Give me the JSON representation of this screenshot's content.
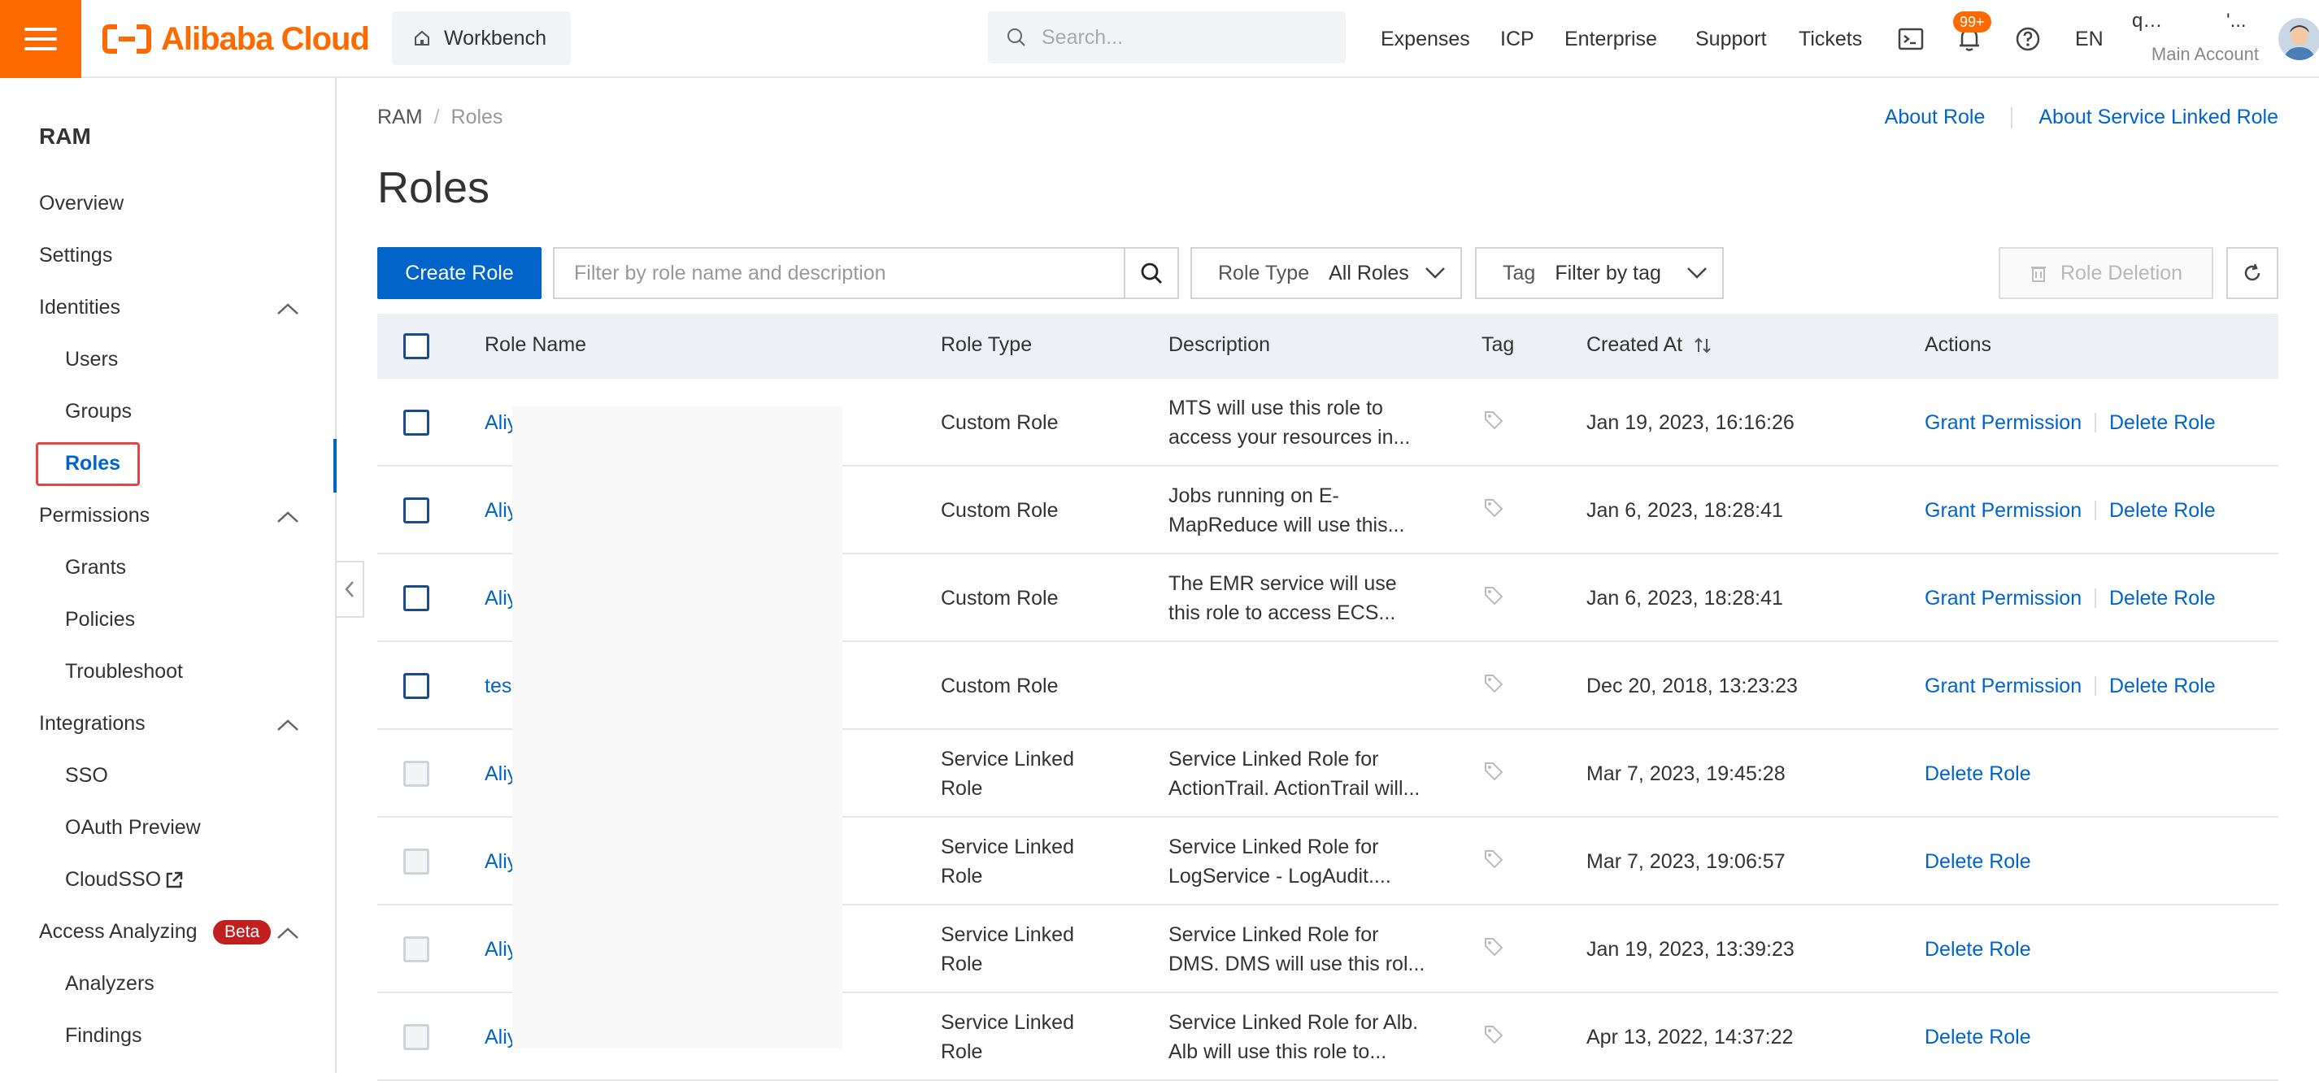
{
  "topbar": {
    "brand": "Alibaba Cloud",
    "workbench": "Workbench",
    "search_placeholder": "Search...",
    "nav": [
      "Expenses",
      "ICP",
      "Enterprise",
      "Support",
      "Tickets"
    ],
    "notification_badge": "99+",
    "language": "EN",
    "account_name": "q…",
    "account_name_tail": "'...",
    "account_type": "Main Account"
  },
  "sidebar": {
    "title": "RAM",
    "overview": "Overview",
    "settings": "Settings",
    "identities": "Identities",
    "users": "Users",
    "groups": "Groups",
    "roles": "Roles",
    "permissions": "Permissions",
    "grants": "Grants",
    "policies": "Policies",
    "troubleshoot": "Troubleshoot",
    "integrations": "Integrations",
    "sso": "SSO",
    "oauth": "OAuth Preview",
    "cloudsso": "CloudSSO",
    "access_analyzing": "Access Analyzing",
    "beta": "Beta",
    "analyzers": "Analyzers",
    "findings": "Findings"
  },
  "main": {
    "breadcrumb": [
      "RAM",
      "Roles"
    ],
    "links": [
      "About Role",
      "About Service Linked Role"
    ],
    "title": "Roles",
    "create_button": "Create Role",
    "filter_placeholder": "Filter by role name and description",
    "role_type_label": "Role Type",
    "role_type_value": "All Roles",
    "tag_label": "Tag",
    "tag_value": "Filter by tag",
    "delete_button": "Role Deletion",
    "columns": [
      "Role Name",
      "Role Type",
      "Description",
      "Tag",
      "Created At",
      "Actions"
    ],
    "rows": [
      {
        "name": "Aliy",
        "type1": "Custom Role",
        "type2": "",
        "desc1": "MTS will use this role to",
        "desc2": "access your resources in...",
        "created": "Jan 19, 2023, 16:16:26",
        "grant": "Grant Permission",
        "delete": "Delete Role"
      },
      {
        "name": "Aliy",
        "type1": "Custom Role",
        "type2": "",
        "desc1": "Jobs running on E-",
        "desc2": "MapReduce will use this...",
        "created": "Jan 6, 2023, 18:28:41",
        "grant": "Grant Permission",
        "delete": "Delete Role"
      },
      {
        "name": "Aliy",
        "type1": "Custom Role",
        "type2": "",
        "desc1": "The EMR service will use",
        "desc2": "this role to access ECS...",
        "created": "Jan 6, 2023, 18:28:41",
        "grant": "Grant Permission",
        "delete": "Delete Role"
      },
      {
        "name": "tes",
        "type1": "Custom Role",
        "type2": "",
        "desc1": "",
        "desc2": "",
        "created": "Dec 20, 2018, 13:23:23",
        "grant": "Grant Permission",
        "delete": "Delete Role"
      },
      {
        "name": "Aliy",
        "type1": "Service Linked",
        "type2": "Role",
        "desc1": "Service Linked Role for",
        "desc2": "ActionTrail. ActionTrail will...",
        "created": "Mar 7, 2023, 19:45:28",
        "grant": "",
        "delete": "Delete Role"
      },
      {
        "name": "Aliy",
        "type1": "Service Linked",
        "type2": "Role",
        "desc1": "Service Linked Role for",
        "desc2": "LogService - LogAudit....",
        "created": "Mar 7, 2023, 19:06:57",
        "grant": "",
        "delete": "Delete Role"
      },
      {
        "name": "Aliy",
        "type1": "Service Linked",
        "type2": "Role",
        "desc1": "Service Linked Role for",
        "desc2": "DMS. DMS will use this rol...",
        "created": "Jan 19, 2023, 13:39:23",
        "grant": "",
        "delete": "Delete Role"
      },
      {
        "name": "Aliy",
        "type1": "Service Linked",
        "type2": "Role",
        "desc1": "Service Linked Role for Alb.",
        "desc2": "Alb will use this role to...",
        "created": "Apr 13, 2022, 14:37:22",
        "grant": "",
        "delete": "Delete Role"
      }
    ]
  }
}
